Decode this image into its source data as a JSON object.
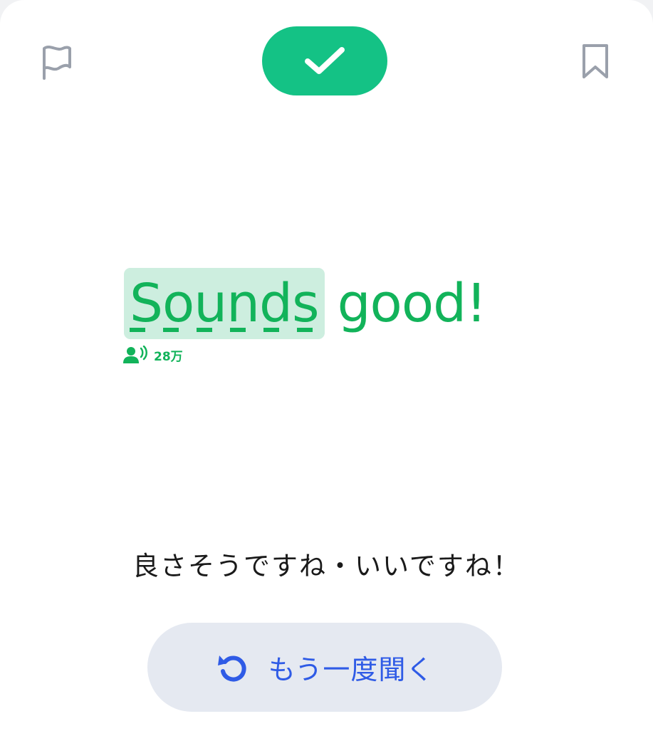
{
  "card": {
    "phrase": {
      "highlighted_word": "Sounds",
      "rest": "good!"
    },
    "listens": {
      "icon": "listener-icon",
      "count": "28万"
    },
    "translation": "良さそうですね・いいですね！",
    "replay_button": {
      "icon": "replay-icon",
      "label": "もう一度聞く"
    },
    "top_bar": {
      "left_icon": "flag-icon",
      "center_icon": "checkmark-icon",
      "right_icon": "bookmark-icon"
    }
  },
  "colors": {
    "correct_green": "#14c285",
    "text_green": "#12b35a",
    "highlight_bg": "#cdeedf",
    "replay_blue": "#2f5be6",
    "replay_bg": "#e5e9f1",
    "icon_gray": "#9aa0ab"
  }
}
